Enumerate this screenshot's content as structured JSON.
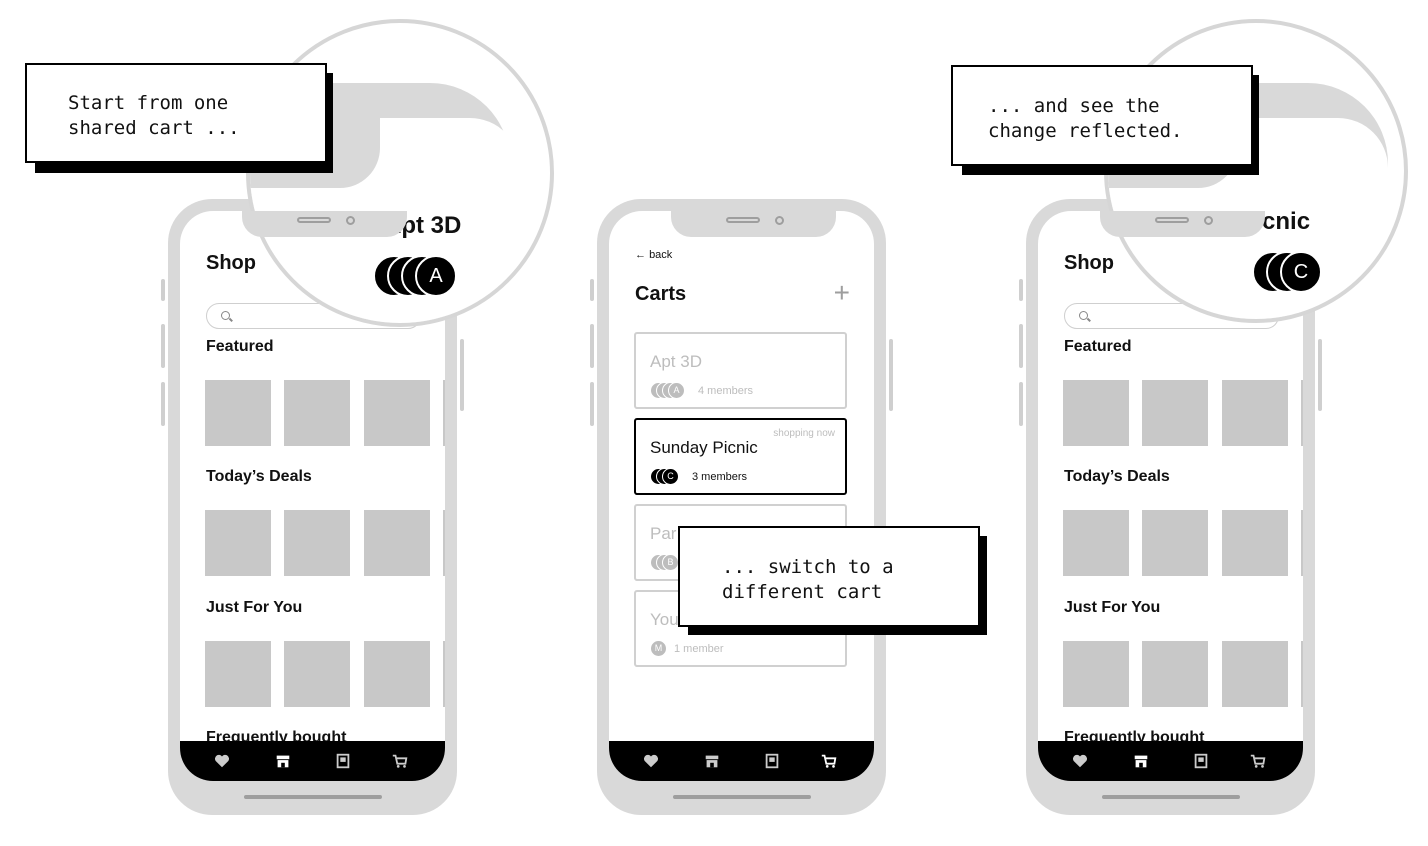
{
  "callouts": {
    "start": "Start from one\nshared cart ...",
    "switch": "... switch to a\ndifferent cart",
    "reflected": "... and see the\nchange reflected."
  },
  "zoom_left": {
    "title": "Apt 3D",
    "avatar_letter": "A"
  },
  "zoom_right": {
    "title": "Sunday Picnic",
    "avatar_letter": "C"
  },
  "shop": {
    "title": "Shop",
    "sections": [
      "Featured",
      "Today’s Deals",
      "Just For You",
      "Frequently bought"
    ]
  },
  "carts_screen": {
    "back_label": "back",
    "title": "Carts",
    "add_label": "+",
    "carts": [
      {
        "name": "Apt 3D",
        "members": "4 members",
        "avatar_letter": "A"
      },
      {
        "name": "Sunday Picnic",
        "members": "3 members",
        "avatar_letter": "C",
        "status": "shopping now"
      },
      {
        "name": "Par",
        "members": "",
        "avatar_letter": "B"
      },
      {
        "name": "You",
        "members": "1 member",
        "avatar_letter": "M"
      }
    ]
  },
  "tabbar_icons": [
    "heart-icon",
    "store-icon",
    "book-icon",
    "cart-icon"
  ],
  "colors": {
    "frame": "#d9d9d9",
    "tile": "#c8c8c8",
    "bar": "#000000",
    "muted": "#bdbdbd"
  }
}
